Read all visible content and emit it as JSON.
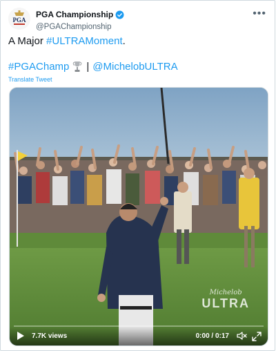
{
  "author": {
    "display_name": "PGA Championship",
    "handle": "@PGAChampionship",
    "avatar_text": "PGA"
  },
  "tweet": {
    "prefix": "A Major ",
    "hashtag1": "#ULTRAMoment",
    "suffix": ".",
    "hashtag2": "#PGAChamp",
    "separator": "|",
    "mention": "@MichelobULTRA",
    "translate": "Translate Tweet"
  },
  "video": {
    "views": "7.7K views",
    "time": "0:00 / 0:17",
    "progress": 0,
    "watermark_top": "Michelob",
    "watermark_bottom": "ULTRA"
  },
  "colors": {
    "link": "#1d9bf0",
    "secondary_text": "#536471",
    "border": "#cfd9de"
  }
}
